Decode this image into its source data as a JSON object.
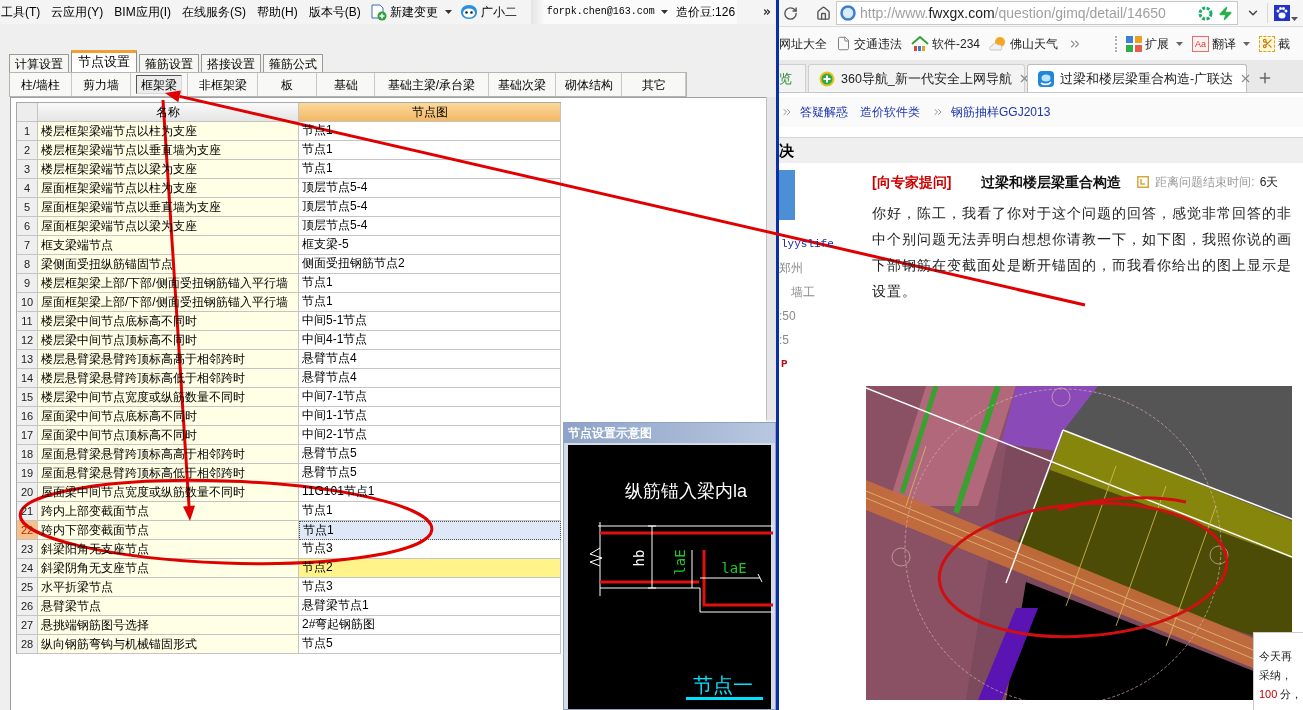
{
  "app": {
    "menu": [
      "工具(T)",
      "云应用(Y)",
      "BIM应用(I)",
      "在线服务(S)",
      "帮助(H)",
      "版本号(B)"
    ],
    "new_change": "新建变更",
    "assistant": "广小二",
    "account": "forpk.chen@163.com",
    "beans": "造价豆:126",
    "tabs": [
      {
        "label": "计算设置",
        "selected": false
      },
      {
        "label": "节点设置",
        "selected": true
      },
      {
        "label": "箍筋设置",
        "selected": false
      },
      {
        "label": "搭接设置",
        "selected": false
      },
      {
        "label": "箍筋公式",
        "selected": false
      }
    ],
    "subtabs": [
      {
        "label": "柱/墙柱",
        "selected": false
      },
      {
        "label": "剪力墙",
        "selected": false
      },
      {
        "label": "框架梁",
        "selected": true
      },
      {
        "label": "非框架梁",
        "selected": false
      },
      {
        "label": "板",
        "selected": false
      },
      {
        "label": "基础",
        "selected": false
      },
      {
        "label": "基础主梁/承台梁",
        "selected": false
      },
      {
        "label": "基础次梁",
        "selected": false
      },
      {
        "label": "砌体结构",
        "selected": false
      },
      {
        "label": "其它",
        "selected": false
      }
    ],
    "table": {
      "columns": [
        "名称",
        "节点图"
      ],
      "rows": [
        {
          "index": "1",
          "name": "楼层框架梁端节点以柱为支座",
          "node": "节点1",
          "selected": false,
          "highlighted": false
        },
        {
          "index": "2",
          "name": "楼层框架梁端节点以垂直墙为支座",
          "node": "节点1",
          "selected": false,
          "highlighted": false
        },
        {
          "index": "3",
          "name": "楼层框架梁端节点以梁为支座",
          "node": "节点1",
          "selected": false,
          "highlighted": false
        },
        {
          "index": "4",
          "name": "屋面框架梁端节点以柱为支座",
          "node": "顶层节点5-4",
          "selected": false,
          "highlighted": false
        },
        {
          "index": "5",
          "name": "屋面框架梁端节点以垂直墙为支座",
          "node": "顶层节点5-4",
          "selected": false,
          "highlighted": false
        },
        {
          "index": "6",
          "name": "屋面框架梁端节点以梁为支座",
          "node": "顶层节点5-4",
          "selected": false,
          "highlighted": false
        },
        {
          "index": "7",
          "name": "框支梁端节点",
          "node": "框支梁-5",
          "selected": false,
          "highlighted": false
        },
        {
          "index": "8",
          "name": "梁侧面受扭纵筋锚固节点",
          "node": "侧面受扭钢筋节点2",
          "selected": false,
          "highlighted": false
        },
        {
          "index": "9",
          "name": "楼层框架梁上部/下部/侧面受扭钢筋锚入平行墙",
          "node": "节点1",
          "selected": false,
          "highlighted": false
        },
        {
          "index": "10",
          "name": "屋面框架梁上部/下部/侧面受扭钢筋锚入平行墙",
          "node": "节点1",
          "selected": false,
          "highlighted": false
        },
        {
          "index": "11",
          "name": "楼层梁中间节点底标高不同时",
          "node": "中间5-1节点",
          "selected": false,
          "highlighted": false
        },
        {
          "index": "12",
          "name": "楼层梁中间节点顶标高不同时",
          "node": "中间4-1节点",
          "selected": false,
          "highlighted": false
        },
        {
          "index": "13",
          "name": "楼层悬臂梁悬臂跨顶标高高于相邻跨时",
          "node": "悬臂节点4",
          "selected": false,
          "highlighted": false
        },
        {
          "index": "14",
          "name": "楼层悬臂梁悬臂跨顶标高低于相邻跨时",
          "node": "悬臂节点4",
          "selected": false,
          "highlighted": false
        },
        {
          "index": "15",
          "name": "楼层梁中间节点宽度或纵筋数量不同时",
          "node": "中间7-1节点",
          "selected": false,
          "highlighted": false
        },
        {
          "index": "16",
          "name": "屋面梁中间节点底标高不同时",
          "node": "中间1-1节点",
          "selected": false,
          "highlighted": false
        },
        {
          "index": "17",
          "name": "屋面梁中间节点顶标高不同时",
          "node": "中间2-1节点",
          "selected": false,
          "highlighted": false
        },
        {
          "index": "18",
          "name": "屋面悬臂梁悬臂跨顶标高高于相邻跨时",
          "node": "悬臂节点5",
          "selected": false,
          "highlighted": false
        },
        {
          "index": "19",
          "name": "屋面悬臂梁悬臂跨顶标高低于相邻跨时",
          "node": "悬臂节点5",
          "selected": false,
          "highlighted": false
        },
        {
          "index": "20",
          "name": "屋面梁中间节点宽度或纵筋数量不同时",
          "node": "11G101节点1",
          "selected": false,
          "highlighted": false
        },
        {
          "index": "21",
          "name": "跨内上部变截面节点",
          "node": "节点1",
          "selected": false,
          "highlighted": false
        },
        {
          "index": "22",
          "name": "跨内下部变截面节点",
          "node": "节点1",
          "selected": true,
          "highlighted": false
        },
        {
          "index": "23",
          "name": "斜梁阳角无支座节点",
          "node": "节点3",
          "selected": false,
          "highlighted": false
        },
        {
          "index": "24",
          "name": "斜梁阴角无支座节点",
          "node": "节点2",
          "selected": false,
          "highlighted": true
        },
        {
          "index": "25",
          "name": "水平折梁节点",
          "node": "节点3",
          "selected": false,
          "highlighted": false
        },
        {
          "index": "26",
          "name": "悬臂梁节点",
          "node": "悬臂梁节点1",
          "selected": false,
          "highlighted": false
        },
        {
          "index": "27",
          "name": "悬挑端钢筋图号选择",
          "node": "2#弯起钢筋图",
          "selected": false,
          "highlighted": false
        },
        {
          "index": "28",
          "name": "纵向钢筋弯钩与机械锚固形式",
          "node": "节点5",
          "selected": false,
          "highlighted": false
        }
      ]
    },
    "preview": {
      "title": "节点设置示意图",
      "heading": "纵筋锚入梁内la",
      "labels": [
        "hb",
        "laE",
        "laE"
      ],
      "caption": "节点一"
    }
  },
  "browser": {
    "address": {
      "scheme": "http://www.",
      "host": "fwxgx.com",
      "path": "/question/gimq/detail/14650"
    },
    "bookmarks": [
      {
        "label": "网址大全",
        "kind": "plain"
      },
      {
        "label": "交通违法",
        "kind": "page"
      },
      {
        "label": "软件-234",
        "kind": "house"
      },
      {
        "label": "佛山天气",
        "kind": "weather"
      }
    ],
    "tools": [
      {
        "label": "扩展",
        "kind": "extensions",
        "dropdown": true
      },
      {
        "label": "翻译",
        "kind": "translate",
        "icon_text": "Aa",
        "dropdown": true
      },
      {
        "label": "截",
        "kind": "capture",
        "dropdown": false
      }
    ],
    "tabs": [
      {
        "label": "览",
        "selected": false,
        "kind": "partial"
      },
      {
        "label": "360导航_新一代安全上网导航",
        "selected": false,
        "kind": "nav"
      },
      {
        "label": "过梁和楼层梁重合构造-广联达",
        "selected": true,
        "kind": "site"
      }
    ],
    "breadcrumb": [
      {
        "label": "答疑解惑",
        "separator_before": true
      },
      {
        "label": "造价软件类",
        "separator_before": false
      },
      {
        "label": "钢筋抽样GGJ2013",
        "separator_before": true
      }
    ],
    "section_title": "决",
    "user": {
      "name": "lyyslife",
      "city": "郑州",
      "trade": "墙工",
      "stats": [
        ":50",
        ":5"
      ],
      "badge": "P"
    },
    "question": {
      "tag": "[向专家提问]",
      "title": "过梁和楼层梁重合构造",
      "deadline_label": "距离问题结束时间:",
      "deadline_value": "6天",
      "lines": [
        "你好，陈工，我看了你对于这个问题的回答，感觉非常回答的非",
        "中个别问题无法弄明白想想你请教一下，如下图，我照你说的画",
        "下部钢筋在变截面处是断开锚固的，而我看你给出的图上显示是",
        "设置。"
      ]
    },
    "notice": {
      "lines": [
        "今天再",
        "采纳，"
      ],
      "points": "100",
      "unit": "分，"
    }
  }
}
